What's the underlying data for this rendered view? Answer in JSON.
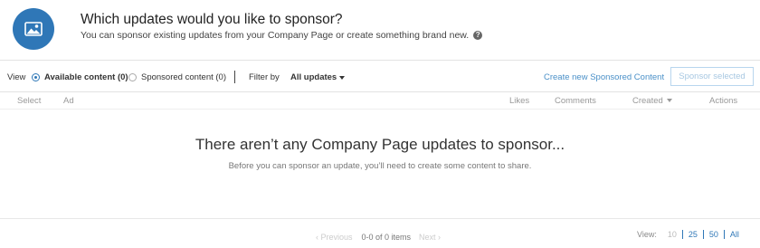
{
  "header": {
    "title": "Which updates would you like to sponsor?",
    "subtitle": "You can sponsor existing updates from your Company Page or create something brand new.",
    "icon": "image-icon",
    "accent": "#2f77b7"
  },
  "toolbar": {
    "view_label": "View",
    "radio_available": "Available content (0)",
    "radio_sponsored": "Sponsored content (0)",
    "filter_label": "Filter by",
    "filter_value": "All updates",
    "create_link": "Create new Sponsored Content",
    "sponsor_button": "Sponsor selected"
  },
  "table": {
    "columns": [
      "Select",
      "Ad",
      "Likes",
      "Comments",
      "Created",
      "Actions"
    ]
  },
  "empty": {
    "title": "There aren’t any Company Page updates to sponsor...",
    "subtitle": "Before you can sponsor an update, you’ll need to create some content to share."
  },
  "footer": {
    "previous": "‹ Previous",
    "range": "0-0 of 0 items",
    "next": "Next ›",
    "view_label": "View:",
    "view_options": [
      "10",
      "25",
      "50",
      "All"
    ]
  }
}
